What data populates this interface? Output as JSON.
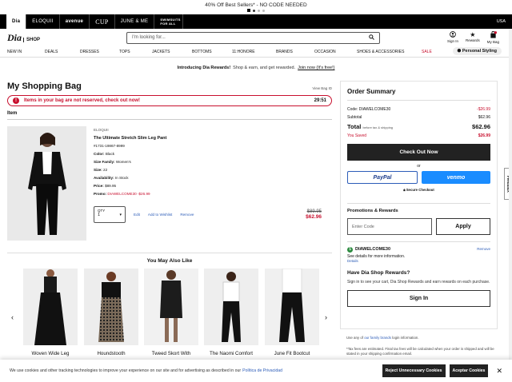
{
  "promo": {
    "text": "40% Off Best Sellers* - NO CODE NEEDED"
  },
  "brands": [
    "Dia",
    "ELOQUII",
    "avenue",
    "CUP",
    "JUNE & ME",
    "SWIMSUITS FOR ALL"
  ],
  "region": "USA",
  "header": {
    "logo": "Dia",
    "logo_sub": "SHOP",
    "search_placeholder": "I'm looking for...",
    "signin": "Sign In",
    "rewards": "Rewards",
    "mybag": "My Bag",
    "bag_count": "1"
  },
  "nav": [
    "NEW IN",
    "DEALS",
    "DRESSES",
    "TOPS",
    "JACKETS",
    "BOTTOMS",
    "11:HONORE",
    "BRANDS",
    "OCCASION",
    "SHOES & ACCESSORIES",
    "SALE"
  ],
  "personal_styling": "Personal Styling",
  "rewards_banner": {
    "bold": "Introducing Dia Rewards!",
    "text": "Shop & earn, and get rewarded.",
    "link": "Join now (It's free!)"
  },
  "bag": {
    "title": "My Shopping Bag",
    "view_bag": "View Bag ID",
    "alert": "Items in your bag are not reserved, check out now!",
    "timer": "29:51",
    "item_header": "Item",
    "product": {
      "brand": "ELOQUII",
      "name": "The Ultimate Stretch Slim Leg Pant",
      "sku": "#1731-19867-8999",
      "color_label": "Color:",
      "color": "Black",
      "size_family_label": "Size Family:",
      "size_family": "Women's",
      "size_label": "Size:",
      "size": "22",
      "availability_label": "Availability:",
      "availability": "In Stock",
      "price_label": "Price:",
      "price": "$89.95",
      "promo_label": "Promo:",
      "promo": "DIAWELCOME30 -$26.99",
      "qty_label": "QTY",
      "qty": "1",
      "edit": "Edit",
      "wishlist": "Add to Wishlist",
      "remove": "Remove",
      "orig_price": "$89.95",
      "sale_price": "$62.96"
    }
  },
  "recommendations": {
    "title": "You May Also Like",
    "items": [
      "Woven Wide Leg",
      "Houndstooth",
      "Tweed Skort With",
      "The Naomi Comfort",
      "June Fit Bootcut"
    ]
  },
  "summary": {
    "title": "Order Summary",
    "code_label": "Code: DIAWELCOME30",
    "code_value": "-$26.99",
    "subtotal_label": "Subtotal",
    "subtotal": "$62.96",
    "total_label": "Total",
    "total_note": "before tax & shipping",
    "total": "$62.96",
    "saved_label": "You Saved",
    "saved": "$26.99",
    "checkout": "Check Out Now",
    "or": "or",
    "paypal": "PayPal",
    "venmo": "venmo",
    "secure": "Secure Checkout",
    "promo_title": "Promotions & Rewards",
    "promo_placeholder": "Enter Code",
    "apply": "Apply",
    "coupon_code": "DIAWELCOME30",
    "coupon_remove": "Remove",
    "coupon_desc": "See details for more information.",
    "coupon_details": "Details",
    "shop_title": "Have Dia Shop Rewards?",
    "shop_text": "Sign in to see your cart, Dia Shop Rewards and earn rewards on each purchase.",
    "signin": "Sign In"
  },
  "under": {
    "prefix": "Use any of",
    "link": "our family brands",
    "suffix": "login information.",
    "note": "*Tax fees are estimated. Final tax fees will be calculated when your order is shipped and will be stated in your shipping confirmation email."
  },
  "feedback": "Feedback",
  "cookie": {
    "text": "We use cookies and other tracking technologies to improve your experience on our site and for advertising as described in our",
    "link": "Política de Privacidad",
    "reject": "Reject Unnecessary Cookies",
    "accept": "Aceptar Cookies"
  }
}
